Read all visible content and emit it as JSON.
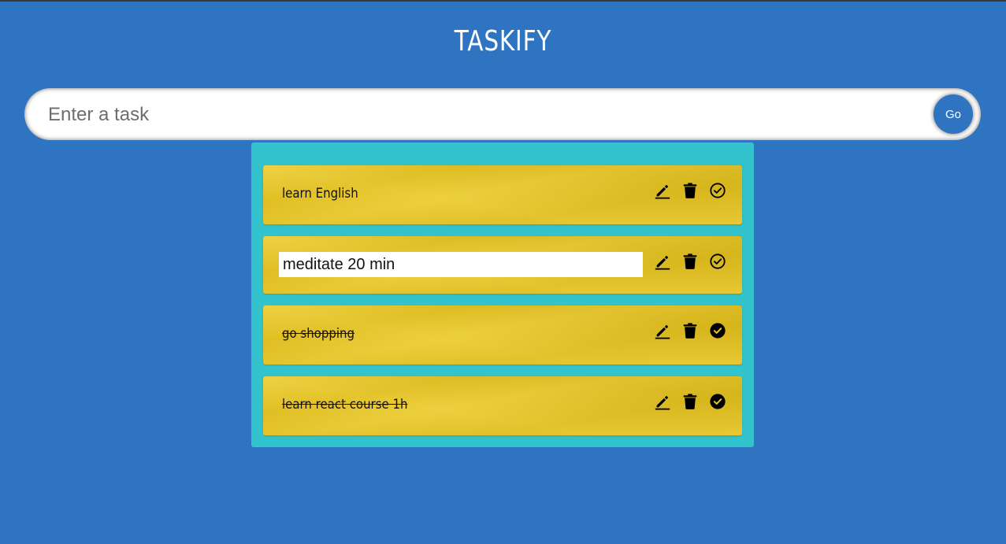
{
  "app": {
    "title": "TASKIFY"
  },
  "new_task": {
    "placeholder": "Enter a task",
    "value": "",
    "submit_label": "Go"
  },
  "tasks": [
    {
      "text": "learn English",
      "done": false,
      "editing": false
    },
    {
      "text": "meditate 20 min",
      "done": false,
      "editing": true
    },
    {
      "text": "go shopping",
      "done": true,
      "editing": false
    },
    {
      "text": "learn react course 1h",
      "done": true,
      "editing": false
    }
  ],
  "icons": {
    "edit": "edit-icon",
    "delete": "delete-icon",
    "complete": "check-circle-icon",
    "completed": "check-circle-filled-icon"
  },
  "colors": {
    "background": "#2f74c0",
    "panel": "#32c3cd",
    "card": "#ebc71f",
    "button": "#2f74c0"
  }
}
